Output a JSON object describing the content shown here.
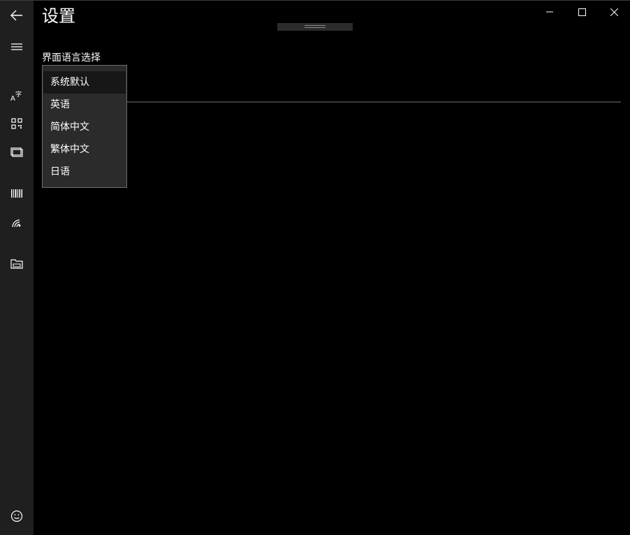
{
  "window": {
    "title": "设置",
    "controls": {
      "minimize_icon": "minimize-icon",
      "maximize_icon": "maximize-icon",
      "close_icon": "close-icon"
    }
  },
  "nav": {
    "back_icon": "back-arrow-icon",
    "menu_icon": "hamburger-menu-icon",
    "items": [
      {
        "icon": "text-translate-icon"
      },
      {
        "icon": "qr-code-icon"
      },
      {
        "icon": "screen-capture-icon"
      },
      {
        "icon": "barcode-icon"
      },
      {
        "icon": "nfc-signal-icon"
      },
      {
        "icon": "folder-icon"
      }
    ],
    "feedback_icon": "smiley-icon"
  },
  "settings": {
    "language_label": "界面语言选择",
    "language_options": [
      "系统默认",
      "英语",
      "简体中文",
      "繁体中文",
      "日语"
    ],
    "selected_language": "系统默认"
  },
  "colors": {
    "background": "#000000",
    "rail": "#1f1f1f",
    "dropdown": "#2b2b2b",
    "dropdown_border": "#6e6e6e",
    "selected_item": "#171717",
    "text": "#ffffff"
  }
}
